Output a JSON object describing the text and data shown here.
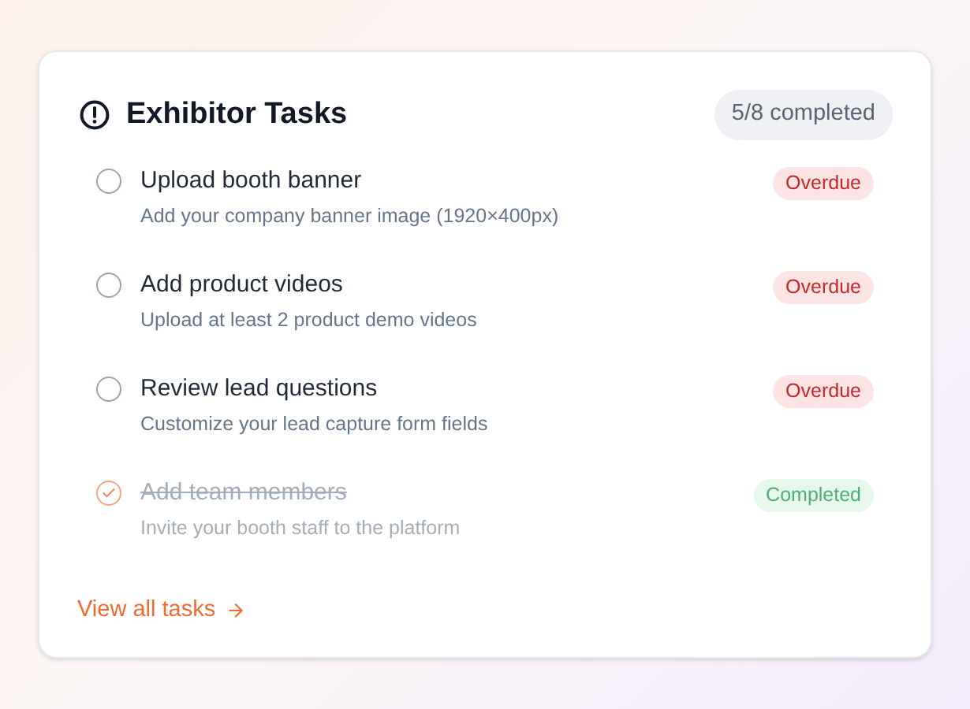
{
  "card": {
    "title": "Exhibitor Tasks",
    "progress": "5/8 completed",
    "tasks": [
      {
        "title": "Upload booth banner",
        "description": "Add your company banner image (1920×400px)",
        "checked": false,
        "kind": "overdue",
        "badge": "Overdue"
      },
      {
        "title": "Add product videos",
        "description": "Upload at least 2 product demo videos",
        "checked": false,
        "kind": "overdue",
        "badge": "Overdue"
      },
      {
        "title": "Review lead questions",
        "description": "Customize your lead capture form fields",
        "checked": false,
        "kind": "overdue",
        "badge": "Overdue"
      },
      {
        "title": "Add team members",
        "description": "Invite your booth staff to the platform",
        "checked": true,
        "kind": "completed",
        "badge": "Completed"
      }
    ],
    "link": "View all tasks"
  }
}
